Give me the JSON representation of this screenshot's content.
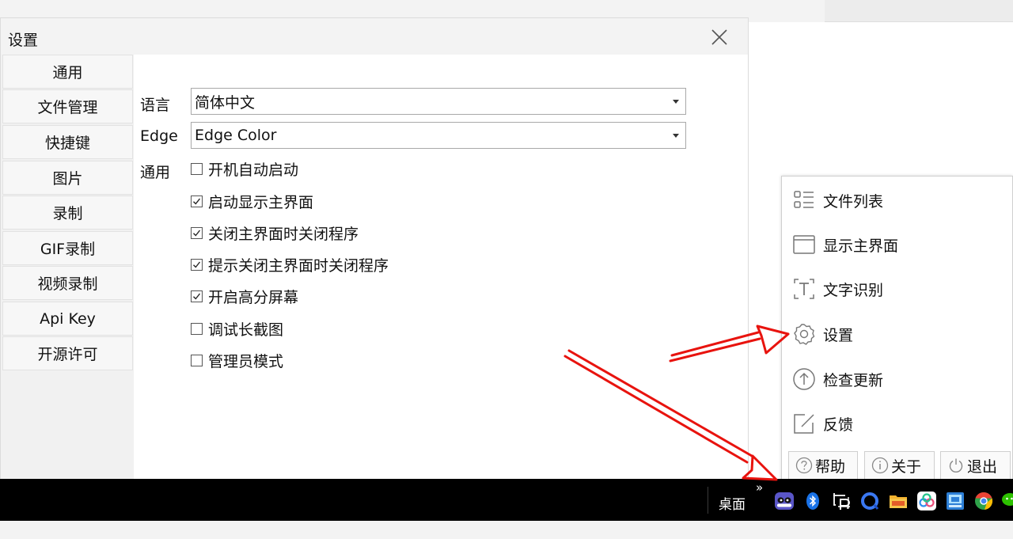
{
  "window": {
    "title": "设置"
  },
  "sidebar": {
    "items": [
      {
        "label": "通用"
      },
      {
        "label": "文件管理"
      },
      {
        "label": "快捷键"
      },
      {
        "label": "图片"
      },
      {
        "label": "录制"
      },
      {
        "label": "GIF录制"
      },
      {
        "label": "视频录制"
      },
      {
        "label": "Api Key"
      },
      {
        "label": "开源许可"
      }
    ]
  },
  "settings": {
    "language": {
      "label": "语言",
      "value": "简体中文"
    },
    "edge": {
      "label": "Edge",
      "value": "Edge Color"
    },
    "general": {
      "label": "通用",
      "options": [
        {
          "label": "开机自动启动",
          "checked": false
        },
        {
          "label": "启动显示主界面",
          "checked": true
        },
        {
          "label": "关闭主界面时关闭程序",
          "checked": true
        },
        {
          "label": "提示关闭主界面时关闭程序",
          "checked": true
        },
        {
          "label": "开启高分屏幕",
          "checked": true
        },
        {
          "label": "调试长截图",
          "checked": false
        },
        {
          "label": "管理员模式",
          "checked": false
        }
      ]
    }
  },
  "tray_menu": {
    "items": [
      {
        "label": "文件列表",
        "icon": "file-list-icon"
      },
      {
        "label": "显示主界面",
        "icon": "window-icon"
      },
      {
        "label": "文字识别",
        "icon": "text-recognition-icon"
      },
      {
        "label": "设置",
        "icon": "gear-icon"
      },
      {
        "label": "检查更新",
        "icon": "upload-arrow-icon"
      },
      {
        "label": "反馈",
        "icon": "edit-icon"
      }
    ],
    "buttons": [
      {
        "label": "帮助",
        "icon": "help-icon"
      },
      {
        "label": "关于",
        "icon": "info-icon"
      },
      {
        "label": "退出",
        "icon": "power-icon"
      }
    ]
  },
  "taskbar": {
    "overflow": "»",
    "desktop_label": "桌面",
    "tray_icons": [
      "panda-app-icon",
      "bluetooth-icon",
      "screenshot-app-icon",
      "blue-circle-app-icon",
      "folder-app-icon",
      "cloud-app-icon",
      "network-app-icon",
      "chrome-icon",
      "wechat-icon"
    ]
  },
  "colors": {
    "arrow": "#e8130e",
    "checkmark": "#222222",
    "taskbar": "#000000"
  }
}
